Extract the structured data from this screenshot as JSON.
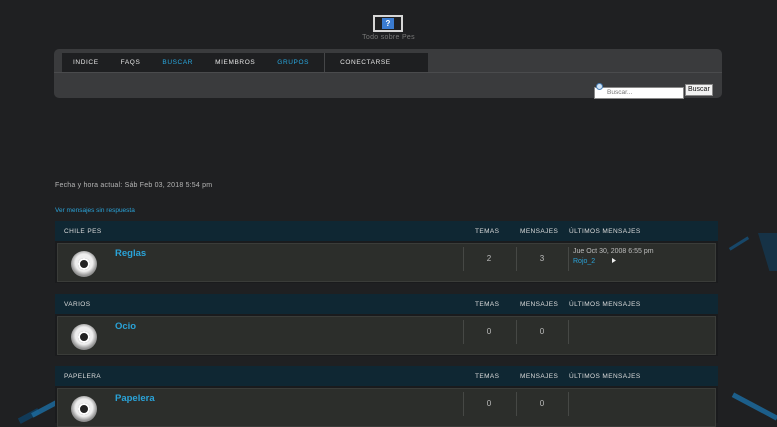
{
  "site": {
    "title": "Todo sobre Pes",
    "logo_glyph": "?"
  },
  "nav": {
    "items": [
      {
        "label": "INDICE",
        "highlight": false
      },
      {
        "label": "FAQS",
        "highlight": false
      },
      {
        "label": "BUSCAR",
        "highlight": true
      },
      {
        "label": "MIEMBROS",
        "highlight": false
      },
      {
        "label": "GRUPOS",
        "highlight": true
      },
      {
        "label": "CONECTARSE",
        "highlight": false
      }
    ]
  },
  "search": {
    "placeholder": "Buscar...",
    "button_label": "Buscar"
  },
  "datetime": "Fecha y hora actual: Sáb Feb 03, 2018 5:54 pm",
  "unanswered_link": "Ver mensajes sin respuesta",
  "headers": {
    "topics": "TEMAS",
    "posts": "MENSAJES",
    "last": "ÚLTIMOS MENSAJES"
  },
  "categories": [
    {
      "name": "CHILE PES",
      "forums": [
        {
          "name": "Reglas",
          "topics": "2",
          "posts": "3",
          "last_date": "Jue Oct 30, 2008 6:55 pm",
          "last_user": "Rojo_2"
        }
      ]
    },
    {
      "name": "VARIOS",
      "forums": [
        {
          "name": "Ocio",
          "topics": "0",
          "posts": "0"
        }
      ]
    },
    {
      "name": "PAPELERA",
      "forums": [
        {
          "name": "Papelera",
          "topics": "0",
          "posts": "0"
        }
      ]
    }
  ],
  "colors": {
    "accent": "#29a8e0",
    "background": "#1f2022",
    "category_bar": "#0f2733"
  }
}
